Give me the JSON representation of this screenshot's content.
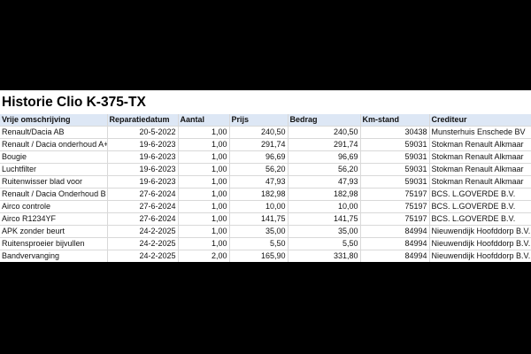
{
  "sheet": {
    "title": "Historie Clio K-375-TX",
    "columns": [
      "Vrije omschrijving",
      "Reparatiedatum",
      "Aantal",
      "Prijs",
      "Bedrag",
      "Km-stand",
      "Crediteur"
    ],
    "rows": [
      [
        "Renault/Dacia AB",
        "20-5-2022",
        "1,00",
        "240,50",
        "240,50",
        "30438",
        "Munsterhuis Enschede BV"
      ],
      [
        "Renault / Dacia onderhoud A+",
        "19-6-2023",
        "1,00",
        "291,74",
        "291,74",
        "59031",
        "Stokman Renault Alkmaar"
      ],
      [
        "Bougie",
        "19-6-2023",
        "1,00",
        "96,69",
        "96,69",
        "59031",
        "Stokman Renault Alkmaar"
      ],
      [
        "Luchtfilter",
        "19-6-2023",
        "1,00",
        "56,20",
        "56,20",
        "59031",
        "Stokman Renault Alkmaar"
      ],
      [
        "Ruitenwisser blad voor",
        "19-6-2023",
        "1,00",
        "47,93",
        "47,93",
        "59031",
        "Stokman Renault Alkmaar"
      ],
      [
        "Renault / Dacia Onderhoud B",
        "27-6-2024",
        "1,00",
        "182,98",
        "182,98",
        "75197",
        "BCS. L.GOVERDE B.V."
      ],
      [
        "Airco controle",
        "27-6-2024",
        "1,00",
        "10,00",
        "10,00",
        "75197",
        "BCS. L.GOVERDE B.V."
      ],
      [
        "Airco R1234YF",
        "27-6-2024",
        "1,00",
        "141,75",
        "141,75",
        "75197",
        "BCS. L.GOVERDE B.V."
      ],
      [
        "APK zonder beurt",
        "24-2-2025",
        "1,00",
        "35,00",
        "35,00",
        "84994",
        "Nieuwendijk Hoofddorp B.V."
      ],
      [
        "Ruitensproeier bijvullen",
        "24-2-2025",
        "1,00",
        "5,50",
        "5,50",
        "84994",
        "Nieuwendijk Hoofddorp B.V."
      ],
      [
        "Bandvervanging",
        "24-2-2025",
        "2,00",
        "165,90",
        "331,80",
        "84994",
        "Nieuwendijk Hoofddorp B.V."
      ]
    ]
  },
  "colors": {
    "page_background": "#000000",
    "sheet_background": "#ffffff",
    "header_fill": "#dde7f5",
    "gridline": "#d9d9d9"
  }
}
